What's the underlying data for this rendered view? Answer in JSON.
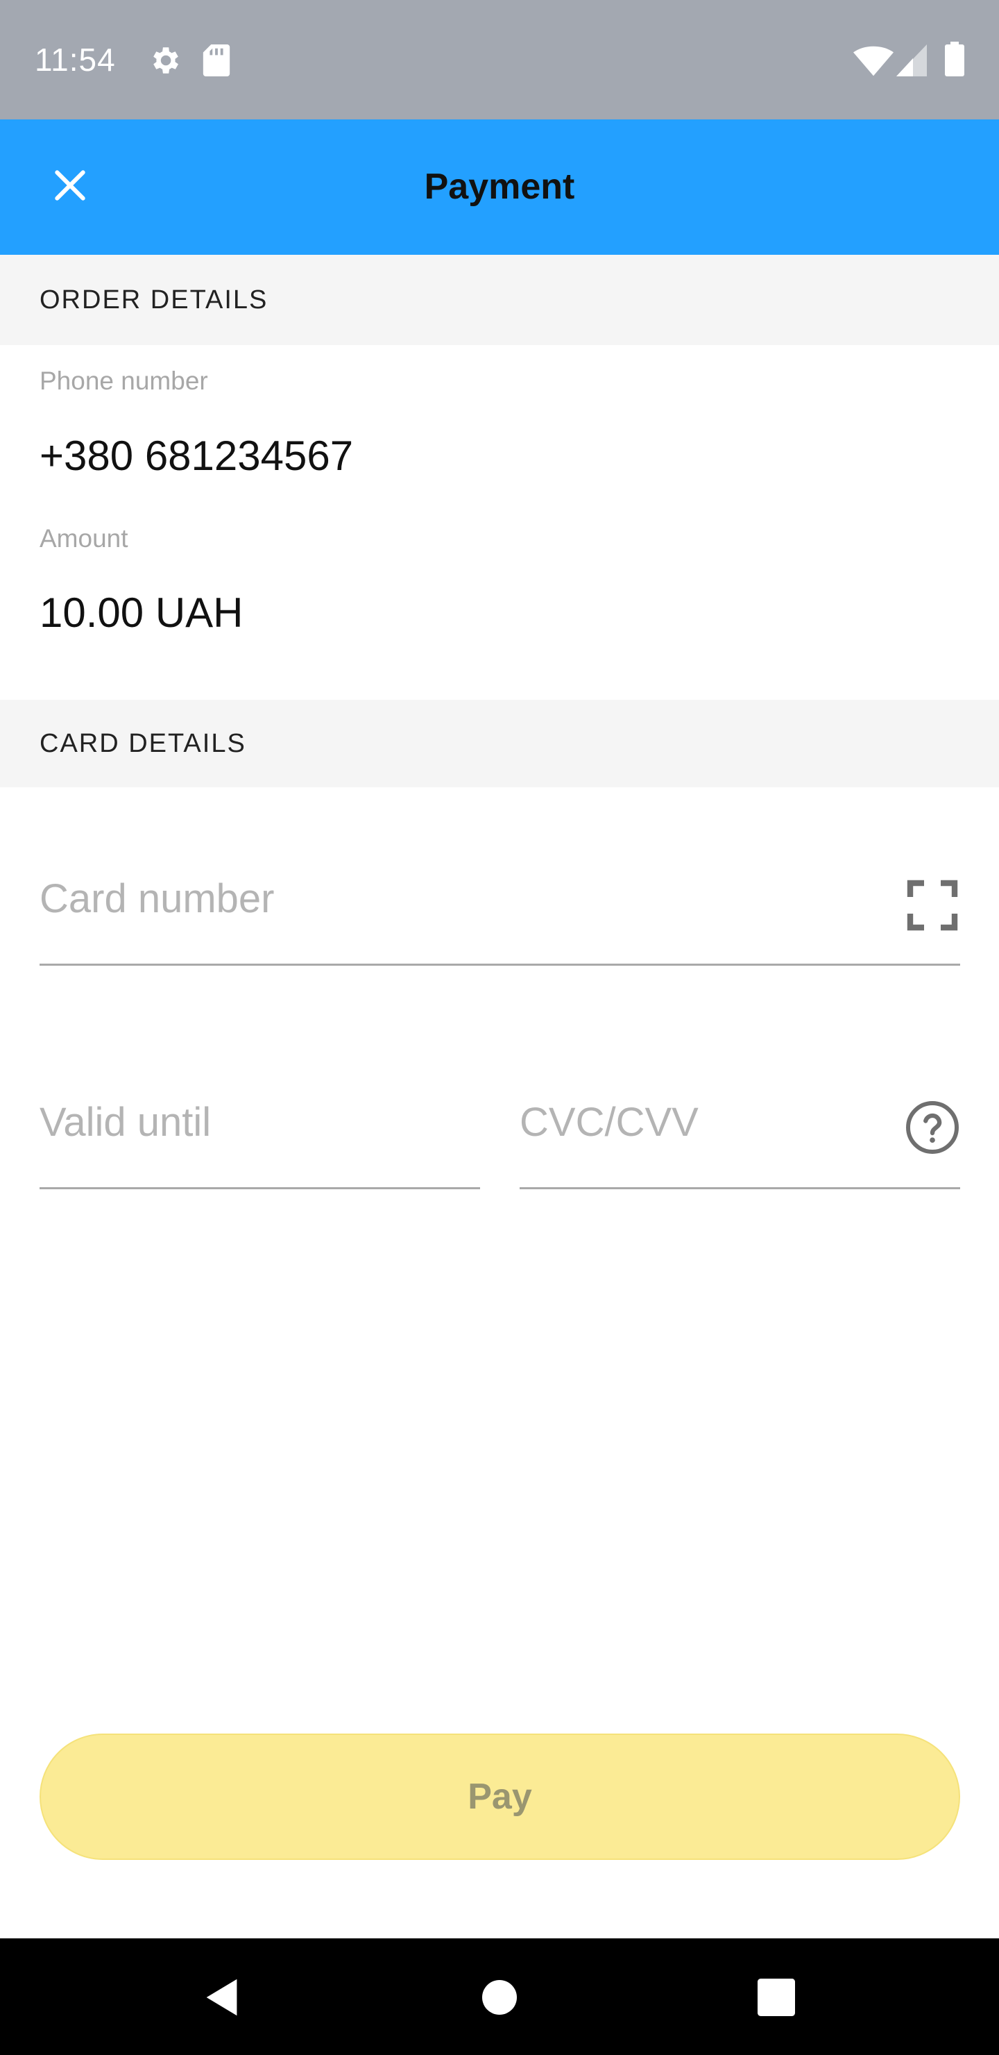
{
  "status_bar": {
    "time": "11:54",
    "icons": [
      "gear-icon",
      "sd-card-icon",
      "wifi-icon",
      "cell-signal-icon",
      "battery-icon"
    ]
  },
  "app_bar": {
    "title": "Payment",
    "close_icon": "close-icon",
    "background": "#23a0ff"
  },
  "order_details": {
    "header": "ORDER DETAILS",
    "phone_label": "Phone number",
    "phone_value": "+380 681234567",
    "amount_label": "Amount",
    "amount_value": "10.00 UAH"
  },
  "card_details": {
    "header": "CARD DETAILS",
    "card_number_placeholder": "Card number",
    "scan_icon": "scan-card-icon",
    "valid_until_placeholder": "Valid until",
    "cvc_placeholder": "CVC/CVV",
    "help_icon": "help-circle-icon"
  },
  "pay_button": {
    "label": "Pay",
    "background": "#fbeb95"
  },
  "nav_bar": {
    "icons": [
      "back-icon",
      "home-icon",
      "recents-icon"
    ]
  }
}
